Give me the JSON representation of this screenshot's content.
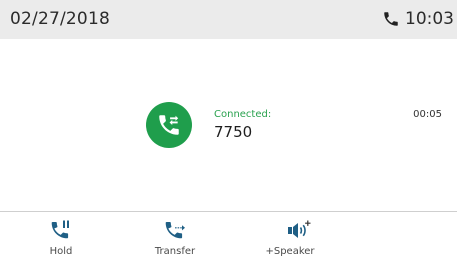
{
  "status_bar": {
    "date": "02/27/2018",
    "time": "10:03",
    "icon": "phone-icon"
  },
  "call": {
    "state": "Connected:",
    "number": "7750",
    "duration": "00:05",
    "avatar_icon": "call-transfer-icon",
    "accent_color": "#1f9e4c"
  },
  "softkeys": [
    {
      "label": "Hold",
      "icon": "hold-icon"
    },
    {
      "label": "Transfer",
      "icon": "transfer-icon"
    },
    {
      "label": "+Speaker",
      "icon": "speaker-icon"
    }
  ]
}
